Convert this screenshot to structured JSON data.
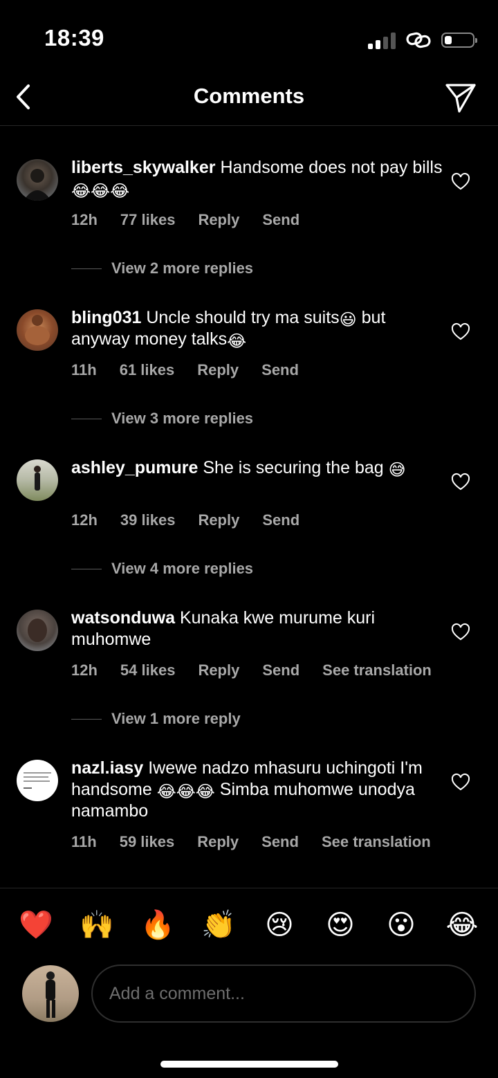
{
  "status_bar": {
    "time": "18:39"
  },
  "header": {
    "title": "Comments",
    "back_icon": "chevron-left-icon",
    "share_icon": "paper-plane-icon"
  },
  "comments": [
    {
      "username": "liberts_skywalker",
      "text": "Handsome does not pay bills",
      "emojis": "😂😂😂",
      "time": "12h",
      "likes": "77 likes",
      "reply": "Reply",
      "send": "Send",
      "translation": "",
      "view_replies": "View 2 more replies"
    },
    {
      "username": "bling031",
      "text": "Uncle should try ma suits",
      "text_emoji": "😃",
      "text2": "but anyway money talks",
      "emojis": "😂",
      "time": "11h",
      "likes": "61 likes",
      "reply": "Reply",
      "send": "Send",
      "translation": "",
      "view_replies": "View 3 more replies"
    },
    {
      "username": "ashley_pumure",
      "text": "She is securing the bag",
      "emojis": "😅",
      "time": "12h",
      "likes": "39 likes",
      "reply": "Reply",
      "send": "Send",
      "translation": "",
      "view_replies": "View 4 more replies"
    },
    {
      "username": "watsonduwa",
      "text": "Kunaka kwe murume kuri muhomwe",
      "emojis": "",
      "time": "12h",
      "likes": "54 likes",
      "reply": "Reply",
      "send": "Send",
      "translation": "See translation",
      "view_replies": "View 1 more reply"
    },
    {
      "username": "nazl.iasy",
      "text": "Iwewe nadzo mhasuru uchingoti I'm handsome",
      "emojis": "😂😂😂",
      "text2": "Simba muhomwe unodya namambo",
      "time": "11h",
      "likes": "59 likes",
      "reply": "Reply",
      "send": "Send",
      "translation": "See translation"
    }
  ],
  "reactions": [
    "❤️",
    "🙌",
    "🔥",
    "👏",
    "😢",
    "😍",
    "😮",
    "😂"
  ],
  "composer": {
    "placeholder": "Add a comment..."
  },
  "colors": {
    "background": "#000000",
    "text": "#ffffff",
    "meta": "#a8a8a8",
    "divider": "#262626"
  }
}
